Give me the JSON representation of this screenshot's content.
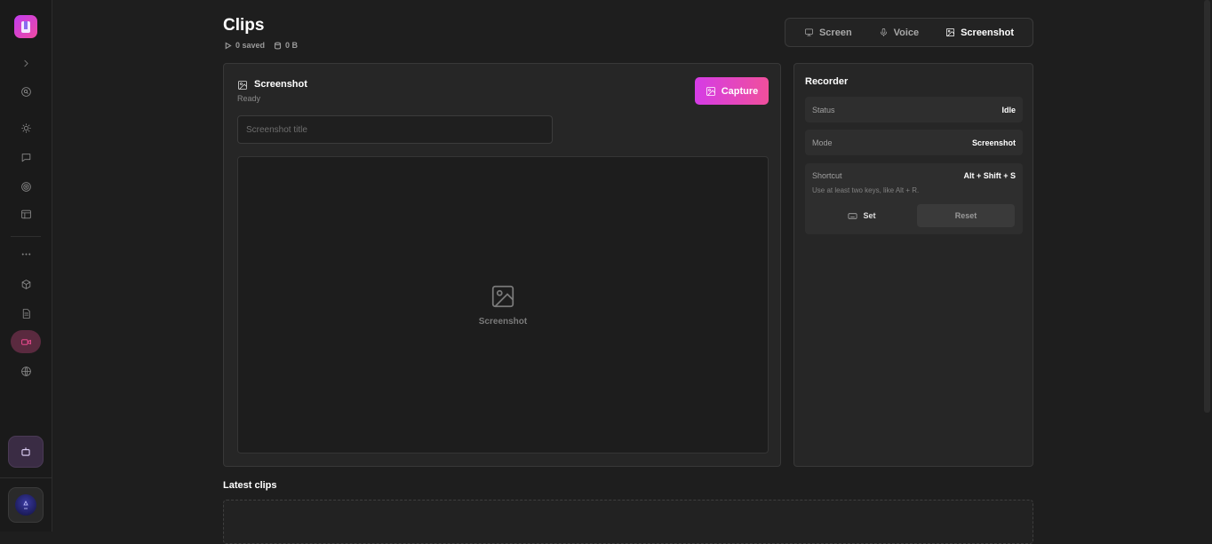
{
  "page": {
    "title": "Clips",
    "saved_count": "0 saved",
    "storage_size": "0 B"
  },
  "tabs": [
    {
      "label": "Screen",
      "icon": "monitor-icon"
    },
    {
      "label": "Voice",
      "icon": "mic-icon"
    },
    {
      "label": "Screenshot",
      "icon": "image-icon",
      "active": true
    }
  ],
  "capture_panel": {
    "title": "Screenshot",
    "status": "Ready",
    "capture_label": "Capture",
    "title_placeholder": "Screenshot title",
    "title_value": "",
    "preview_label": "Screenshot"
  },
  "recorder": {
    "title": "Recorder",
    "status_label": "Status",
    "status_value": "Idle",
    "mode_label": "Mode",
    "mode_value": "Screenshot",
    "shortcut_label": "Shortcut",
    "shortcut_value": "Alt + Shift + S",
    "shortcut_help": "Use at least two keys, like Alt + R.",
    "set_label": "Set",
    "reset_label": "Reset"
  },
  "latest": {
    "title": "Latest clips"
  },
  "sidebar": {
    "items": [
      {
        "name": "expand-icon"
      },
      {
        "name": "search-icon"
      },
      {
        "name": "sun-icon"
      },
      {
        "name": "chat-icon"
      },
      {
        "name": "target-icon"
      },
      {
        "name": "layout-icon"
      },
      {
        "name": "more-icon"
      },
      {
        "name": "box-icon"
      },
      {
        "name": "document-icon"
      },
      {
        "name": "video-camera-icon",
        "active": true
      },
      {
        "name": "globe-icon"
      }
    ]
  },
  "colors": {
    "accent_start": "#d53ce6",
    "accent_end": "#f04f9c",
    "active_nav": "#ff4f9a",
    "background": "#1e1e1e"
  }
}
